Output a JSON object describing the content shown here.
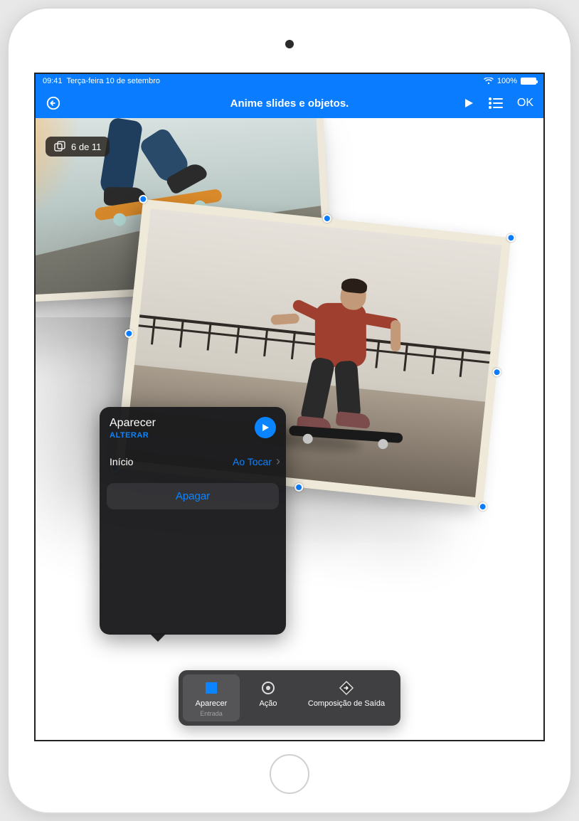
{
  "status": {
    "time": "09:41",
    "date": "Terça-feira 10 de setembro",
    "battery_pct": "100%"
  },
  "nav": {
    "title": "Anime slides e objetos.",
    "done": "OK"
  },
  "slide_counter": "6 de 11",
  "popover": {
    "title": "Aparecer",
    "change": "ALTERAR",
    "start_label": "Início",
    "start_value": "Ao Tocar",
    "delete": "Apagar"
  },
  "segments": {
    "build_in_label": "Aparecer",
    "build_in_sub": "Entrada",
    "action_label": "Ação",
    "build_out_label": "Composição de Saída"
  },
  "colors": {
    "accent": "#0a7cff",
    "popover_accent": "#0a84ff"
  }
}
